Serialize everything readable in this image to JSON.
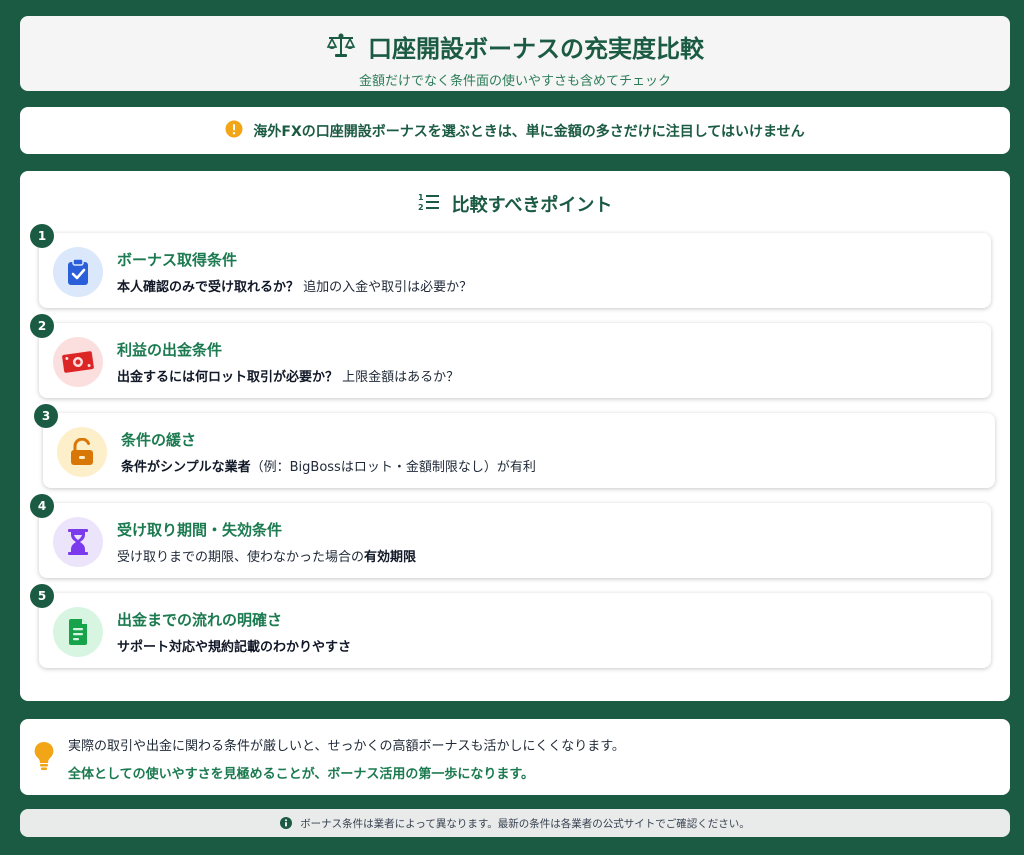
{
  "header": {
    "title": "口座開設ボーナスの充実度比較",
    "subtitle": "金額だけでなく条件面の使いやすさも含めてチェック",
    "icon": "scale-icon"
  },
  "notice": {
    "text": "海外FXの口座開設ボーナスを選ぶときは、単に金額の多さだけに注目してはいけません",
    "icon": "warning-icon"
  },
  "points": {
    "title": "比較すべきポイント",
    "icon": "numbered-list-icon",
    "items": [
      {
        "number": "1",
        "title": "ボーナス取得条件",
        "desc_bold": "本人確認のみで受け取れるか？",
        "desc_rest": " 追加の入金や取引は必要か？",
        "icon": "clipboard-check-icon",
        "color": "#2b5fd9"
      },
      {
        "number": "2",
        "title": "利益の出金条件",
        "desc_bold": "出金するには何ロット取引が必要か？",
        "desc_rest": " 上限金額はあるか？",
        "icon": "money-bill-icon",
        "color": "#dc2626"
      },
      {
        "number": "3",
        "title": "条件の緩さ",
        "desc_bold": "条件がシンプルな業者",
        "desc_rest": "（例：BigBossはロット・金額制限なし）が有利",
        "icon": "unlock-icon",
        "color": "#d97706"
      },
      {
        "number": "4",
        "title": "受け取り期間・失効条件",
        "desc_pre": "受け取りまでの期限、使わなかった場合の",
        "desc_bold": "有効期限",
        "icon": "hourglass-icon",
        "color": "#7c3aed"
      },
      {
        "number": "5",
        "title": "出金までの流れの明確さ",
        "desc_bold": "サポート対応や規約記載のわかりやすさ",
        "icon": "document-icon",
        "color": "#16a34a"
      }
    ]
  },
  "summary": {
    "line1": "実際の取引や出金に関わる条件が厳しいと、せっかくの高額ボーナスも活かしにくくなります。",
    "line2": "全体としての使いやすさを見極めることが、ボーナス活用の第一歩になります。",
    "icon": "lightbulb-icon"
  },
  "footer": {
    "text": "ボーナス条件は業者によって異なります。最新の条件は各業者の公式サイトでご確認ください。",
    "icon": "info-icon"
  }
}
